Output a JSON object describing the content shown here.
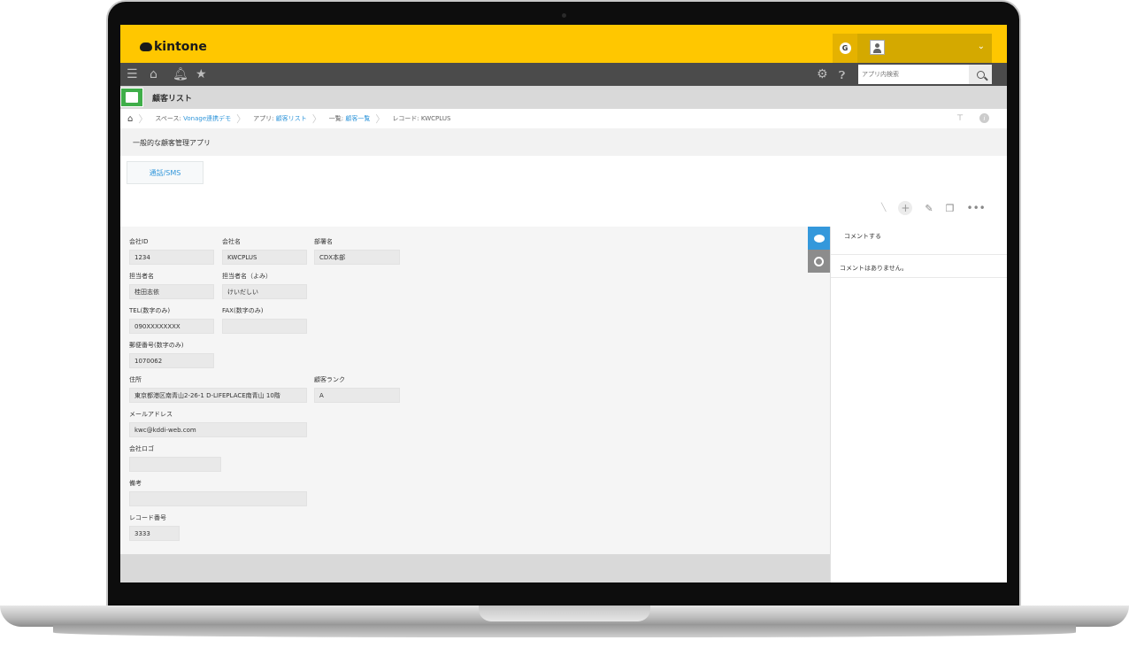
{
  "header": {
    "logo_text": "kintone",
    "user_initial": "G",
    "user_chevron": "⌄"
  },
  "nav": {
    "search_placeholder": "アプリ内検索"
  },
  "app": {
    "title": "顧客リスト"
  },
  "breadcrumb": {
    "space_prefix": "スペース:",
    "space_name": "Vonage連携デモ",
    "app_prefix": "アプリ:",
    "app_name": "顧客リスト",
    "list_prefix": "一覧:",
    "list_name": "顧客一覧",
    "record": "レコード: KWCPLUS"
  },
  "description": "一般的な顧客管理アプリ",
  "tab_label": "通話/SMS",
  "fields": {
    "company_id": {
      "label": "会社ID",
      "value": "1234"
    },
    "company_name": {
      "label": "会社名",
      "value": "KWCPLUS"
    },
    "department": {
      "label": "部署名",
      "value": "CDX本部"
    },
    "contact": {
      "label": "担当者名",
      "value": "桂田志依"
    },
    "contact_kana": {
      "label": "担当者名（よみ）",
      "value": "けいだしい"
    },
    "tel": {
      "label": "TEL(数字のみ)",
      "value": "090XXXXXXXX"
    },
    "fax": {
      "label": "FAX(数字のみ)",
      "value": ""
    },
    "zip": {
      "label": "郵便番号(数字のみ)",
      "value": "1070062"
    },
    "address": {
      "label": "住所",
      "value": "東京都港区南青山2-26-1 D-LIFEPLACE南青山 10階"
    },
    "rank": {
      "label": "顧客ランク",
      "value": "A"
    },
    "email": {
      "label": "メールアドレス",
      "value": "kwc@kddi-web.com"
    },
    "logo": {
      "label": "会社ロゴ",
      "value": ""
    },
    "notes": {
      "label": "備考",
      "value": ""
    },
    "record_no": {
      "label": "レコード番号",
      "value": "3333"
    }
  },
  "comments": {
    "input_placeholder": "コメントする",
    "empty_text": "コメントはありません。"
  },
  "colors": {
    "header": "#ffc700",
    "nav": "#4b4b4b",
    "accent": "#3498db",
    "app_icon": "#3fae49"
  }
}
